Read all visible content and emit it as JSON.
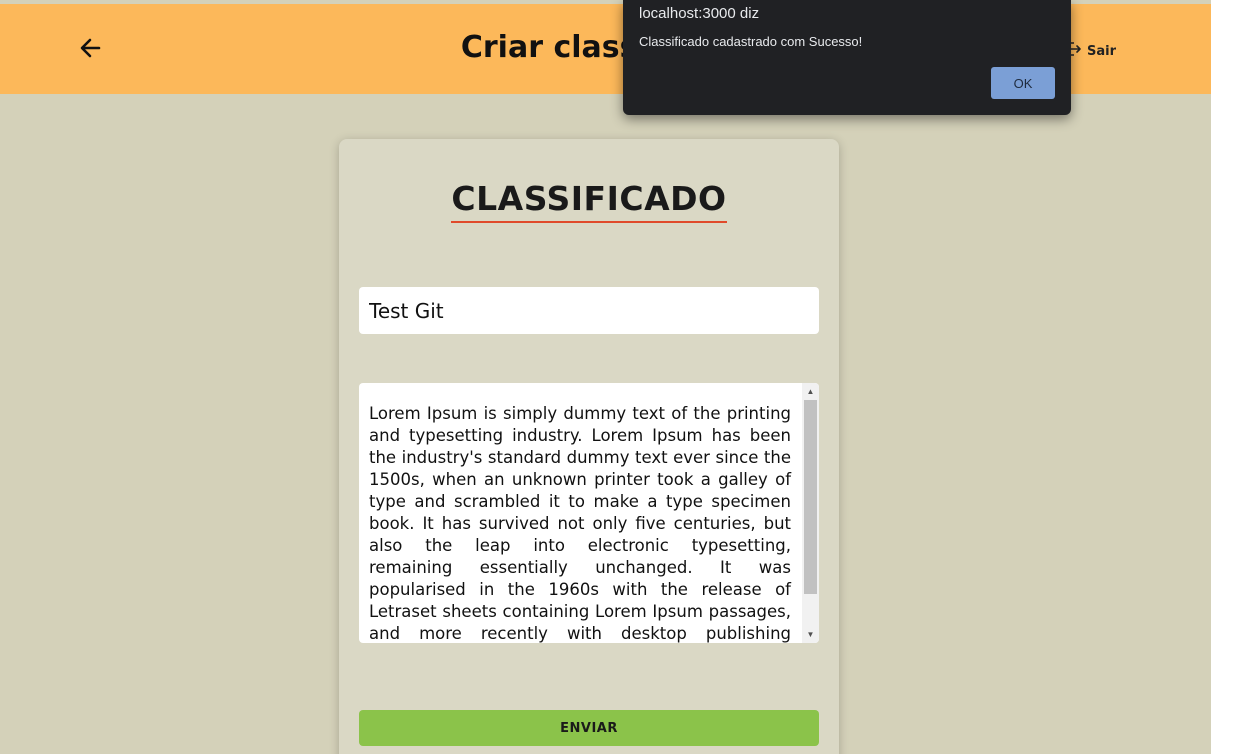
{
  "header": {
    "title": "Criar classificado",
    "logout_label": "Sair",
    "back_icon": "arrow-left-icon",
    "logout_icon": "logout-icon",
    "background": "#fcb85a"
  },
  "card": {
    "title": "CLASSIFICADO",
    "title_input_value": "Test Git",
    "description_value": "Lorem Ipsum is simply dummy text of the printing and typesetting industry. Lorem Ipsum has been the industry's standard dummy text ever since the 1500s, when an unknown printer took a galley of type and scrambled it to make a type specimen book. It has survived not only five centuries, but also the leap into electronic typesetting, remaining essentially unchanged. It was popularised in the 1960s with the release of Letraset sheets containing Lorem Ipsum passages, and more recently with desktop publishing software like Aldus PageMaker including versions of",
    "submit_label": "ENVIAR"
  },
  "dialog": {
    "title": "localhost:3000 diz",
    "message": "Classificado cadastrado com Sucesso!",
    "ok_label": "OK"
  },
  "colors": {
    "page_bg": "#d4d1b9",
    "card_bg": "#dad8c5",
    "accent_underline": "#e04a2b",
    "submit_bg": "#8bc34a",
    "dialog_bg": "#202124",
    "dialog_button": "#7b9fd6"
  }
}
